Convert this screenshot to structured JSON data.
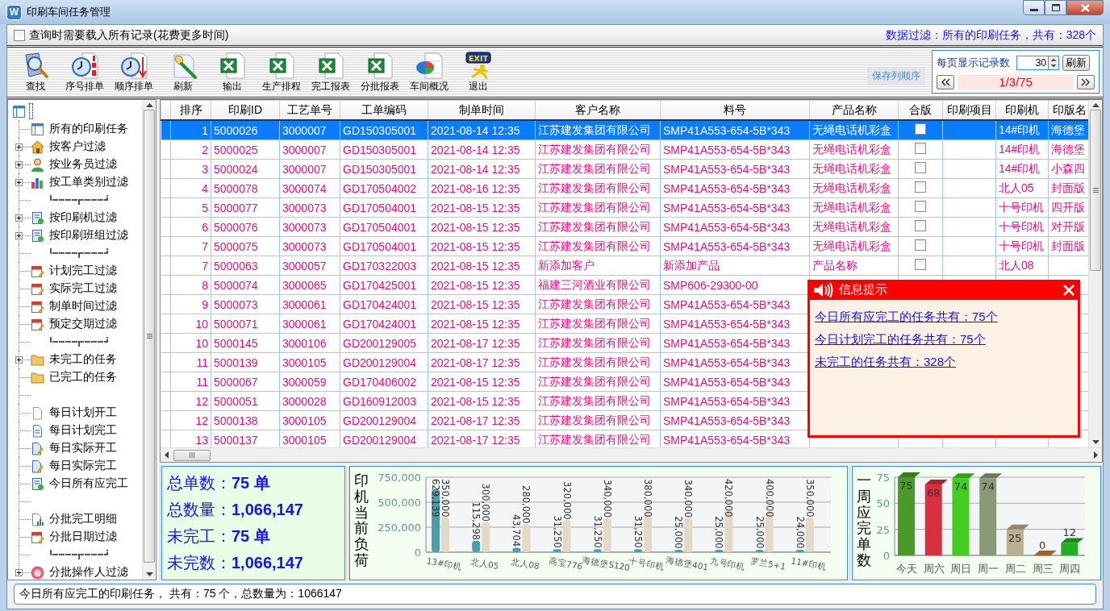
{
  "window": {
    "icon_letter": "W",
    "title": "印刷车间任务管理"
  },
  "options": {
    "load_all": {
      "label": "查询时需要载入所有记录(花费更多时间)",
      "checked": false
    },
    "filter_summary": "数据过滤：所有的印刷任务，共有：328个"
  },
  "toolbar": {
    "buttons": [
      {
        "kind": "search",
        "label": "查找"
      },
      {
        "kind": "clock-numbers",
        "label": "序号排单"
      },
      {
        "kind": "clock-arrow",
        "label": "顺序排单"
      },
      {
        "kind": "brush",
        "label": "刷新"
      },
      {
        "kind": "excel",
        "label": "输出"
      },
      {
        "kind": "excel",
        "label": "生产排程"
      },
      {
        "kind": "excel",
        "label": "完工报表"
      },
      {
        "kind": "excel",
        "label": "分批报表"
      },
      {
        "kind": "pie",
        "label": "车间概况"
      },
      {
        "kind": "exit",
        "label": "退出",
        "badge": "EXIT"
      }
    ],
    "save_link": "保存列顺序",
    "pager": {
      "label": "每页显示记录数",
      "page_size": "30",
      "refresh": "刷新",
      "position": "1/3/75"
    }
  },
  "tree": {
    "root": {
      "kind": "window",
      "children": [
        {
          "kind": "window",
          "label": "所有的印刷任务"
        },
        {
          "kind": "house",
          "label": "按客户过滤",
          "expanded": false
        },
        {
          "kind": "person",
          "label": "按业务员过滤",
          "expanded": false
        },
        {
          "kind": "chart",
          "label": "按工单类别过滤",
          "expanded": false
        },
        {
          "kind": "separator"
        },
        {
          "kind": "notebook",
          "label": "按印刷机过滤",
          "expanded": false
        },
        {
          "kind": "notebook",
          "label": "按印刷班组过滤",
          "expanded": false
        },
        {
          "kind": "separator"
        },
        {
          "kind": "calendar",
          "label": "计划完工过滤"
        },
        {
          "kind": "calendar",
          "label": "实际完工过滤"
        },
        {
          "kind": "calendar",
          "label": "制单时间过滤"
        },
        {
          "kind": "calendar",
          "label": "预定交期过滤"
        },
        {
          "kind": "separator"
        },
        {
          "kind": "folder",
          "label": "未完工的任务",
          "expanded": false
        },
        {
          "kind": "folder",
          "label": "已完工的任务"
        },
        {
          "kind": "gap"
        },
        {
          "kind": "document",
          "label": "每日计划开工"
        },
        {
          "kind": "page",
          "label": "每日计划完工"
        },
        {
          "kind": "edit",
          "label": "每日实际开工"
        },
        {
          "kind": "edit",
          "label": "每日实际完工"
        },
        {
          "kind": "notebook",
          "label": "今日所有应完工"
        },
        {
          "kind": "gap"
        },
        {
          "kind": "report",
          "label": "分批完工明细"
        },
        {
          "kind": "calendar",
          "label": "分批日期过滤"
        },
        {
          "kind": "separator"
        },
        {
          "kind": "avatar",
          "label": "分批操作人过滤",
          "expanded": false
        }
      ]
    }
  },
  "table": {
    "columns": [
      {
        "label": "排序",
        "kind": "number"
      },
      {
        "label": "印刷ID",
        "kind": "text"
      },
      {
        "label": "工艺单号",
        "kind": "text"
      },
      {
        "label": "工单编码",
        "kind": "text"
      },
      {
        "label": "制单时间",
        "kind": "text"
      },
      {
        "label": "客户名称",
        "kind": "text"
      },
      {
        "label": "料号",
        "kind": "text"
      },
      {
        "label": "产品名称",
        "kind": "text"
      },
      {
        "label": "合版",
        "kind": "check"
      },
      {
        "label": "印刷项目",
        "kind": "text"
      },
      {
        "label": "印刷机",
        "kind": "text"
      },
      {
        "label": "印版名",
        "kind": "text"
      }
    ],
    "rows": [
      {
        "selected": true,
        "merged": false,
        "cells": [
          "1",
          "5000026",
          "3000007",
          "GD150305001",
          "2021-08-14 12:35",
          "江苏建发集团有限公司",
          "SMP41A553-654-5B*343",
          "无绳电话机彩盒",
          "",
          "",
          "14#印机",
          "海德堡"
        ]
      },
      {
        "selected": false,
        "merged": false,
        "cells": [
          "2",
          "5000025",
          "3000007",
          "GD150305001",
          "2021-08-14 12:35",
          "江苏建发集团有限公司",
          "SMP41A553-654-5B*343",
          "无绳电话机彩盒",
          "",
          "",
          "14#印机",
          "海德堡"
        ]
      },
      {
        "selected": false,
        "merged": false,
        "cells": [
          "3",
          "5000024",
          "3000007",
          "GD150305001",
          "2021-08-14 12:35",
          "江苏建发集团有限公司",
          "SMP41A553-654-5B*343",
          "无绳电话机彩盒",
          "",
          "",
          "14#印机",
          "小森四"
        ]
      },
      {
        "selected": false,
        "merged": false,
        "cells": [
          "4",
          "5000078",
          "3000074",
          "GD170504002",
          "2021-08-16 12:35",
          "江苏建发集团有限公司",
          "SMP41A553-654-5B*343",
          "无绳电话机彩盒",
          "",
          "",
          "北人05",
          "封面版"
        ]
      },
      {
        "selected": false,
        "merged": false,
        "cells": [
          "5",
          "5000077",
          "3000073",
          "GD170504001",
          "2021-08-15 12:35",
          "江苏建发集团有限公司",
          "SMP41A553-654-5B*343",
          "无绳电话机彩盒",
          "",
          "",
          "十号印机",
          "四开版"
        ]
      },
      {
        "selected": false,
        "merged": false,
        "cells": [
          "6",
          "5000076",
          "3000073",
          "GD170504001",
          "2021-08-15 12:35",
          "江苏建发集团有限公司",
          "SMP41A553-654-5B*343",
          "无绳电话机彩盒",
          "",
          "",
          "十号印机",
          "对开版"
        ]
      },
      {
        "selected": false,
        "merged": false,
        "cells": [
          "7",
          "5000075",
          "3000073",
          "GD170504001",
          "2021-08-15 12:35",
          "江苏建发集团有限公司",
          "SMP41A553-654-5B*343",
          "无绳电话机彩盒",
          "",
          "",
          "十号印机",
          "封面版"
        ]
      },
      {
        "selected": false,
        "merged": false,
        "cells": [
          "7",
          "5000063",
          "3000057",
          "GD170322003",
          "2021-08-15 12:35",
          "新添加客户",
          "新添加产品",
          "产品名称",
          "",
          "",
          "北人08"
        ]
      },
      {
        "selected": false,
        "cells": [
          "8",
          "5000074",
          "3000065",
          "GD170425001",
          "2021-08-15 12:35",
          "福建三河酒业有限公司",
          "SMP606-29300-00"
        ]
      },
      {
        "selected": false,
        "cells": [
          "9",
          "5000073",
          "3000061",
          "GD170424001",
          "2021-08-15 12:35",
          "江苏建发集团有限公司",
          "SMP41A553-654-5B*343"
        ]
      },
      {
        "selected": false,
        "cells": [
          "10",
          "5000071",
          "3000061",
          "GD170424001",
          "2021-08-15 12:35",
          "江苏建发集团有限公司",
          "SMP41A553-654-5B*343"
        ]
      },
      {
        "selected": false,
        "cells": [
          "10",
          "5000145",
          "3000106",
          "GD200129005",
          "2021-08-17 12:35",
          "江苏建发集团有限公司",
          "SMP41A553-654-5B*343"
        ]
      },
      {
        "selected": false,
        "cells": [
          "11",
          "5000139",
          "3000105",
          "GD200129004",
          "2021-08-17 12:35",
          "江苏建发集团有限公司",
          "SMP41A553-654-5B*343"
        ]
      },
      {
        "selected": false,
        "cells": [
          "11",
          "5000067",
          "3000059",
          "GD170406002",
          "2021-08-15 12:35",
          "江苏建发集团有限公司",
          "SMP41A553-654-5B*343"
        ]
      },
      {
        "selected": false,
        "cells": [
          "12",
          "5000051",
          "3000028",
          "GD160912003",
          "2021-08-15 12:35",
          "江苏建发集团有限公司",
          "SMP41A553-654-5B*343"
        ]
      },
      {
        "selected": false,
        "cells": [
          "12",
          "5000138",
          "3000105",
          "GD200129004",
          "2021-08-17 12:35",
          "江苏建发集团有限公司",
          "SMP41A553-654-5B*343"
        ]
      },
      {
        "selected": false,
        "cells": [
          "13",
          "5000137",
          "3000105",
          "GD200129004",
          "2021-08-17 12:35",
          "江苏建发集团有限公司",
          "SMP41A553-654-5B*343"
        ]
      }
    ]
  },
  "popup": {
    "title": "信息提示",
    "links": [
      "今日所有应完工的任务共有：75个",
      "今日计划完工的任务共有：75个",
      "未完工的任务共有：328个"
    ]
  },
  "summary": [
    "总单数：**75 单**",
    "总数量：**1,066,147**",
    "未完工：**75 单**",
    "未完数：**1,066,147**"
  ],
  "load_chart": {
    "chart_data": {
      "type": "bar",
      "title": "印机当前负荷",
      "categories": [
        "13#印机",
        "北人05",
        "北人08",
        "高宝776",
        "海德堡S120",
        "十号印机",
        "海德堡401",
        "九号印机",
        "罗兰5+1",
        "11#印机"
      ],
      "series": [
        {
          "color": "#4a9ea8",
          "values": [
            629139,
            115298,
            43704,
            31250,
            31250,
            31250,
            25000,
            25000,
            25000,
            24000
          ],
          "value_labels": [
            "629,139",
            "115,298",
            "43,704",
            "31,250",
            "31,250",
            "31,250",
            "25,000",
            "25,000",
            "25,000",
            "24,000"
          ]
        },
        {
          "color": "#e3d9c8",
          "values": [
            350000,
            300000,
            280000,
            320000,
            340000,
            380000,
            340000,
            420000,
            400000,
            350000
          ],
          "value_labels": [
            "350,000",
            "300,000",
            "280,000",
            "320,000",
            "340,000",
            "380,000",
            "340,000",
            "420,000",
            "400,000",
            "350,000"
          ]
        }
      ],
      "ylim": [
        0,
        750000
      ],
      "yticks": [
        {
          "value": 0,
          "label": "0"
        },
        {
          "value": 250000,
          "label": "250,000"
        },
        {
          "value": 500000,
          "label": "500,000"
        },
        {
          "value": 750000,
          "label": "750,000"
        }
      ]
    }
  },
  "week_chart": {
    "chart_data": {
      "type": "bar",
      "title": "一周应完单数",
      "categories": [
        "今天",
        "周六",
        "周日",
        "周一",
        "周二",
        "周三",
        "周四"
      ],
      "series": [
        {
          "colors": [
            "#4a9a2a",
            "#d8303e",
            "#44cc22",
            "#8a9a78",
            "#b8b090",
            "#d08030",
            "#22b022"
          ],
          "values": [
            75,
            68,
            74,
            74,
            25,
            0,
            12
          ]
        }
      ],
      "ylim": [
        0,
        75
      ],
      "yticks": [
        0,
        25,
        50,
        75
      ],
      "data_labels": true
    }
  },
  "status_bar": "今日所有应完工的印刷任务， 共有：75 个，总数量为：1066147"
}
